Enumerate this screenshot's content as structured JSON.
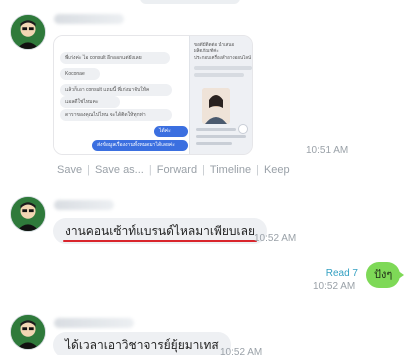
{
  "messages": [
    {
      "type": "image",
      "time": "10:51 AM",
      "actions": [
        "Save",
        "Save as...",
        "Forward",
        "Timeline",
        "Keep"
      ],
      "screenshot": {
        "left_lines": [
          "พี่เก่งค่ะ ไอ consult อีกออกแต่ยังเลย",
          "Koconae",
          "แล้วก็เอา consult แถมนี้ พี่เก่งมาจับให้ค",
          "แอลดีใช่ไหมคะ",
          "ดาราของคุณไปไหน จะได้ติดให้ทุกท่า"
        ],
        "right_lines": [
          "ขอดีมีติดต่อ นำเสนอผลิตภัณฑ์ค่ะ",
          "ประกอบเครื่องสำอางออนไลน์"
        ],
        "blue_bubbles": [
          "ได้ค่ะ",
          "ส่งข้อมูลเรื่องงานทั้งหมดมาได้เลยค่ะ"
        ]
      }
    },
    {
      "type": "text",
      "text": "งานคอนเซ้าท์แบรนด์ไหลมาเพียบเลย",
      "time": "10:52 AM"
    },
    {
      "type": "text-outgoing",
      "read": "Read 7",
      "time": "10:52 AM",
      "text": "ปังๆ"
    },
    {
      "type": "text",
      "text": "ได้เวลาเอาวิชาจารย์ยุ้ยมาเทส",
      "time": "10:52 AM"
    }
  ]
}
